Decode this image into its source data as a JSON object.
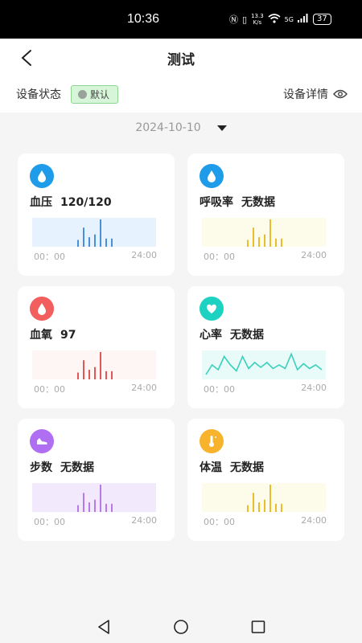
{
  "status_bar": {
    "time": "10:36",
    "net_speed_top": "13.3",
    "net_speed_bottom": "K/s",
    "network": "5G",
    "battery": "37"
  },
  "header": {
    "title": "测试",
    "device_status_label": "设备状态",
    "device_badge": "默认",
    "device_detail_label": "设备详情"
  },
  "date": "2024-10-10",
  "cards": [
    {
      "name": "血压",
      "value": "120/120",
      "icon": "water-drop-icon",
      "icon_color": "#1e9be9",
      "chart_type": "bar",
      "chart_bg": "#e6f2fe",
      "chart_color": "#4a90d9",
      "bars": [
        0.25,
        0.7,
        0.35,
        0.45,
        1.0,
        0.3,
        0.3
      ],
      "start": "00：00",
      "end": "24:00"
    },
    {
      "name": "呼吸率",
      "value": "无数据",
      "icon": "water-drop-icon",
      "icon_color": "#1e9be9",
      "chart_type": "bar",
      "chart_bg": "#fdfbea",
      "chart_color": "#e8be2e",
      "bars": [
        0.25,
        0.7,
        0.35,
        0.45,
        1.0,
        0.3,
        0.3
      ],
      "start": "00：00",
      "end": "24:00"
    },
    {
      "name": "血氧",
      "value": "97",
      "icon": "drop-icon",
      "icon_color": "#f25e5e",
      "chart_type": "bar",
      "chart_bg": "#fef5f5",
      "chart_color": "#e05757",
      "bars": [
        0.25,
        0.7,
        0.35,
        0.45,
        1.0,
        0.3,
        0.3
      ],
      "start": "00：00",
      "end": "24:00"
    },
    {
      "name": "心率",
      "value": "无数据",
      "icon": "heart-icon",
      "icon_color": "#1dd2c0",
      "chart_type": "line",
      "chart_bg": "#e8fbf8",
      "chart_color": "#3ad0bb",
      "line": [
        0.1,
        0.5,
        0.3,
        0.85,
        0.5,
        0.25,
        0.85,
        0.35,
        0.6,
        0.4,
        0.6,
        0.35,
        0.5,
        0.35,
        0.95,
        0.3,
        0.55,
        0.35,
        0.5,
        0.3
      ],
      "start": "00：00",
      "end": "24:00"
    },
    {
      "name": "步数",
      "value": "无数据",
      "icon": "shoe-icon",
      "icon_color": "#b06ef2",
      "chart_type": "bar",
      "chart_bg": "#f3e9fd",
      "chart_color": "#b57be6",
      "bars": [
        0.25,
        0.7,
        0.35,
        0.45,
        1.0,
        0.3,
        0.3
      ],
      "start": "00：00",
      "end": "24:00"
    },
    {
      "name": "体温",
      "value": "无数据",
      "icon": "thermometer-icon",
      "icon_color": "#f7b32b",
      "chart_type": "bar",
      "chart_bg": "#fdfbea",
      "chart_color": "#e8be2e",
      "bars": [
        0.25,
        0.7,
        0.35,
        0.45,
        1.0,
        0.3,
        0.3
      ],
      "start": "00：00",
      "end": "24:00"
    }
  ]
}
